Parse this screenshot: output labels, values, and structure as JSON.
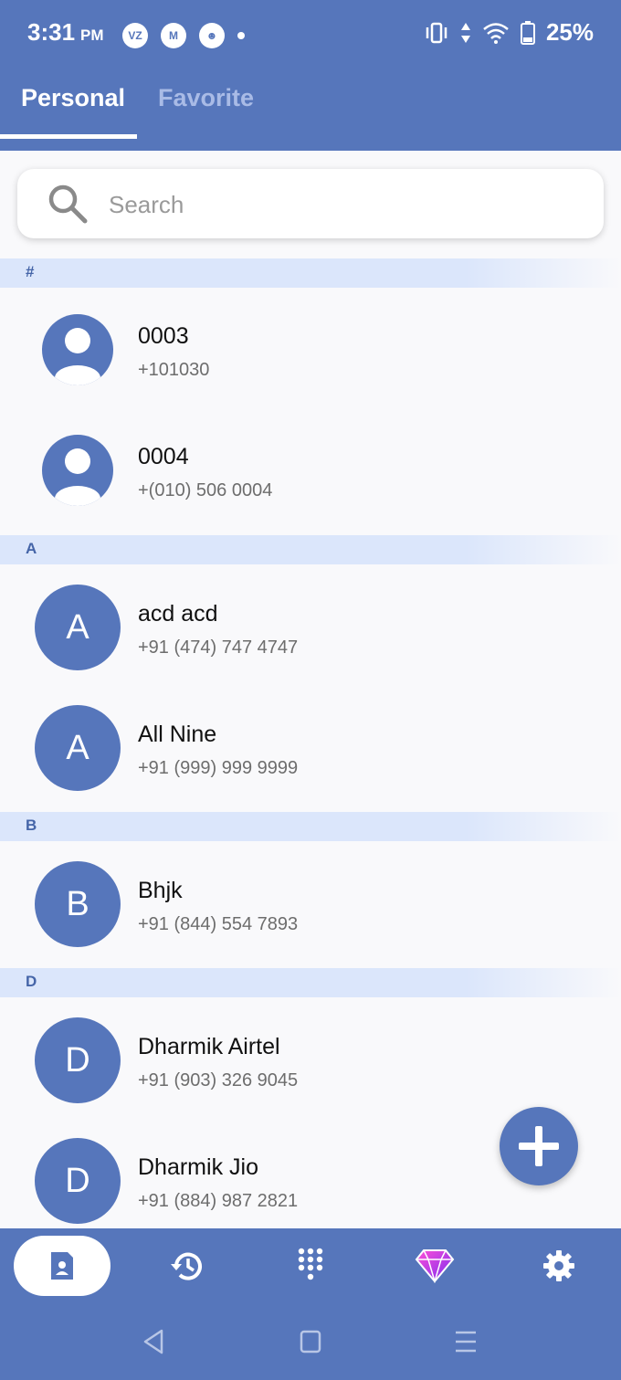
{
  "status_bar": {
    "time": "3:31",
    "ampm": "PM",
    "battery": "25%",
    "notif_icons": [
      "verizon-icon",
      "messages-icon",
      "assistant-icon"
    ]
  },
  "tabs": [
    {
      "label": "Personal",
      "active": true
    },
    {
      "label": "Favorite",
      "active": false
    }
  ],
  "search": {
    "placeholder": "Search"
  },
  "sections": [
    {
      "header": "#",
      "contacts": [
        {
          "name": "0003",
          "phone": "+101030",
          "avatar": "person-icon"
        },
        {
          "name": "0004",
          "phone": "+(010) 506 0004",
          "avatar": "person-icon"
        }
      ]
    },
    {
      "header": "A",
      "contacts": [
        {
          "name": "acd acd",
          "phone": "+91 (474) 747 4747",
          "initial": "A"
        },
        {
          "name": "All Nine",
          "phone": "+91 (999) 999 9999",
          "initial": "A"
        }
      ]
    },
    {
      "header": "B",
      "contacts": [
        {
          "name": "Bhjk",
          "phone": "+91 (844) 554 7893",
          "initial": "B"
        }
      ]
    },
    {
      "header": "D",
      "contacts": [
        {
          "name": "Dharmik Airtel",
          "phone": "+91 (903) 326 9045",
          "initial": "D"
        },
        {
          "name": "Dharmik Jio",
          "phone": "+91 (884) 987 2821",
          "initial": "D"
        }
      ]
    }
  ],
  "bottom_nav": [
    "contacts-icon",
    "history-icon",
    "dialpad-icon",
    "premium-gem-icon",
    "settings-icon"
  ],
  "colors": {
    "primary": "#5676bb",
    "section_bg": "#dbe6fb",
    "section_text": "#4565a8"
  }
}
